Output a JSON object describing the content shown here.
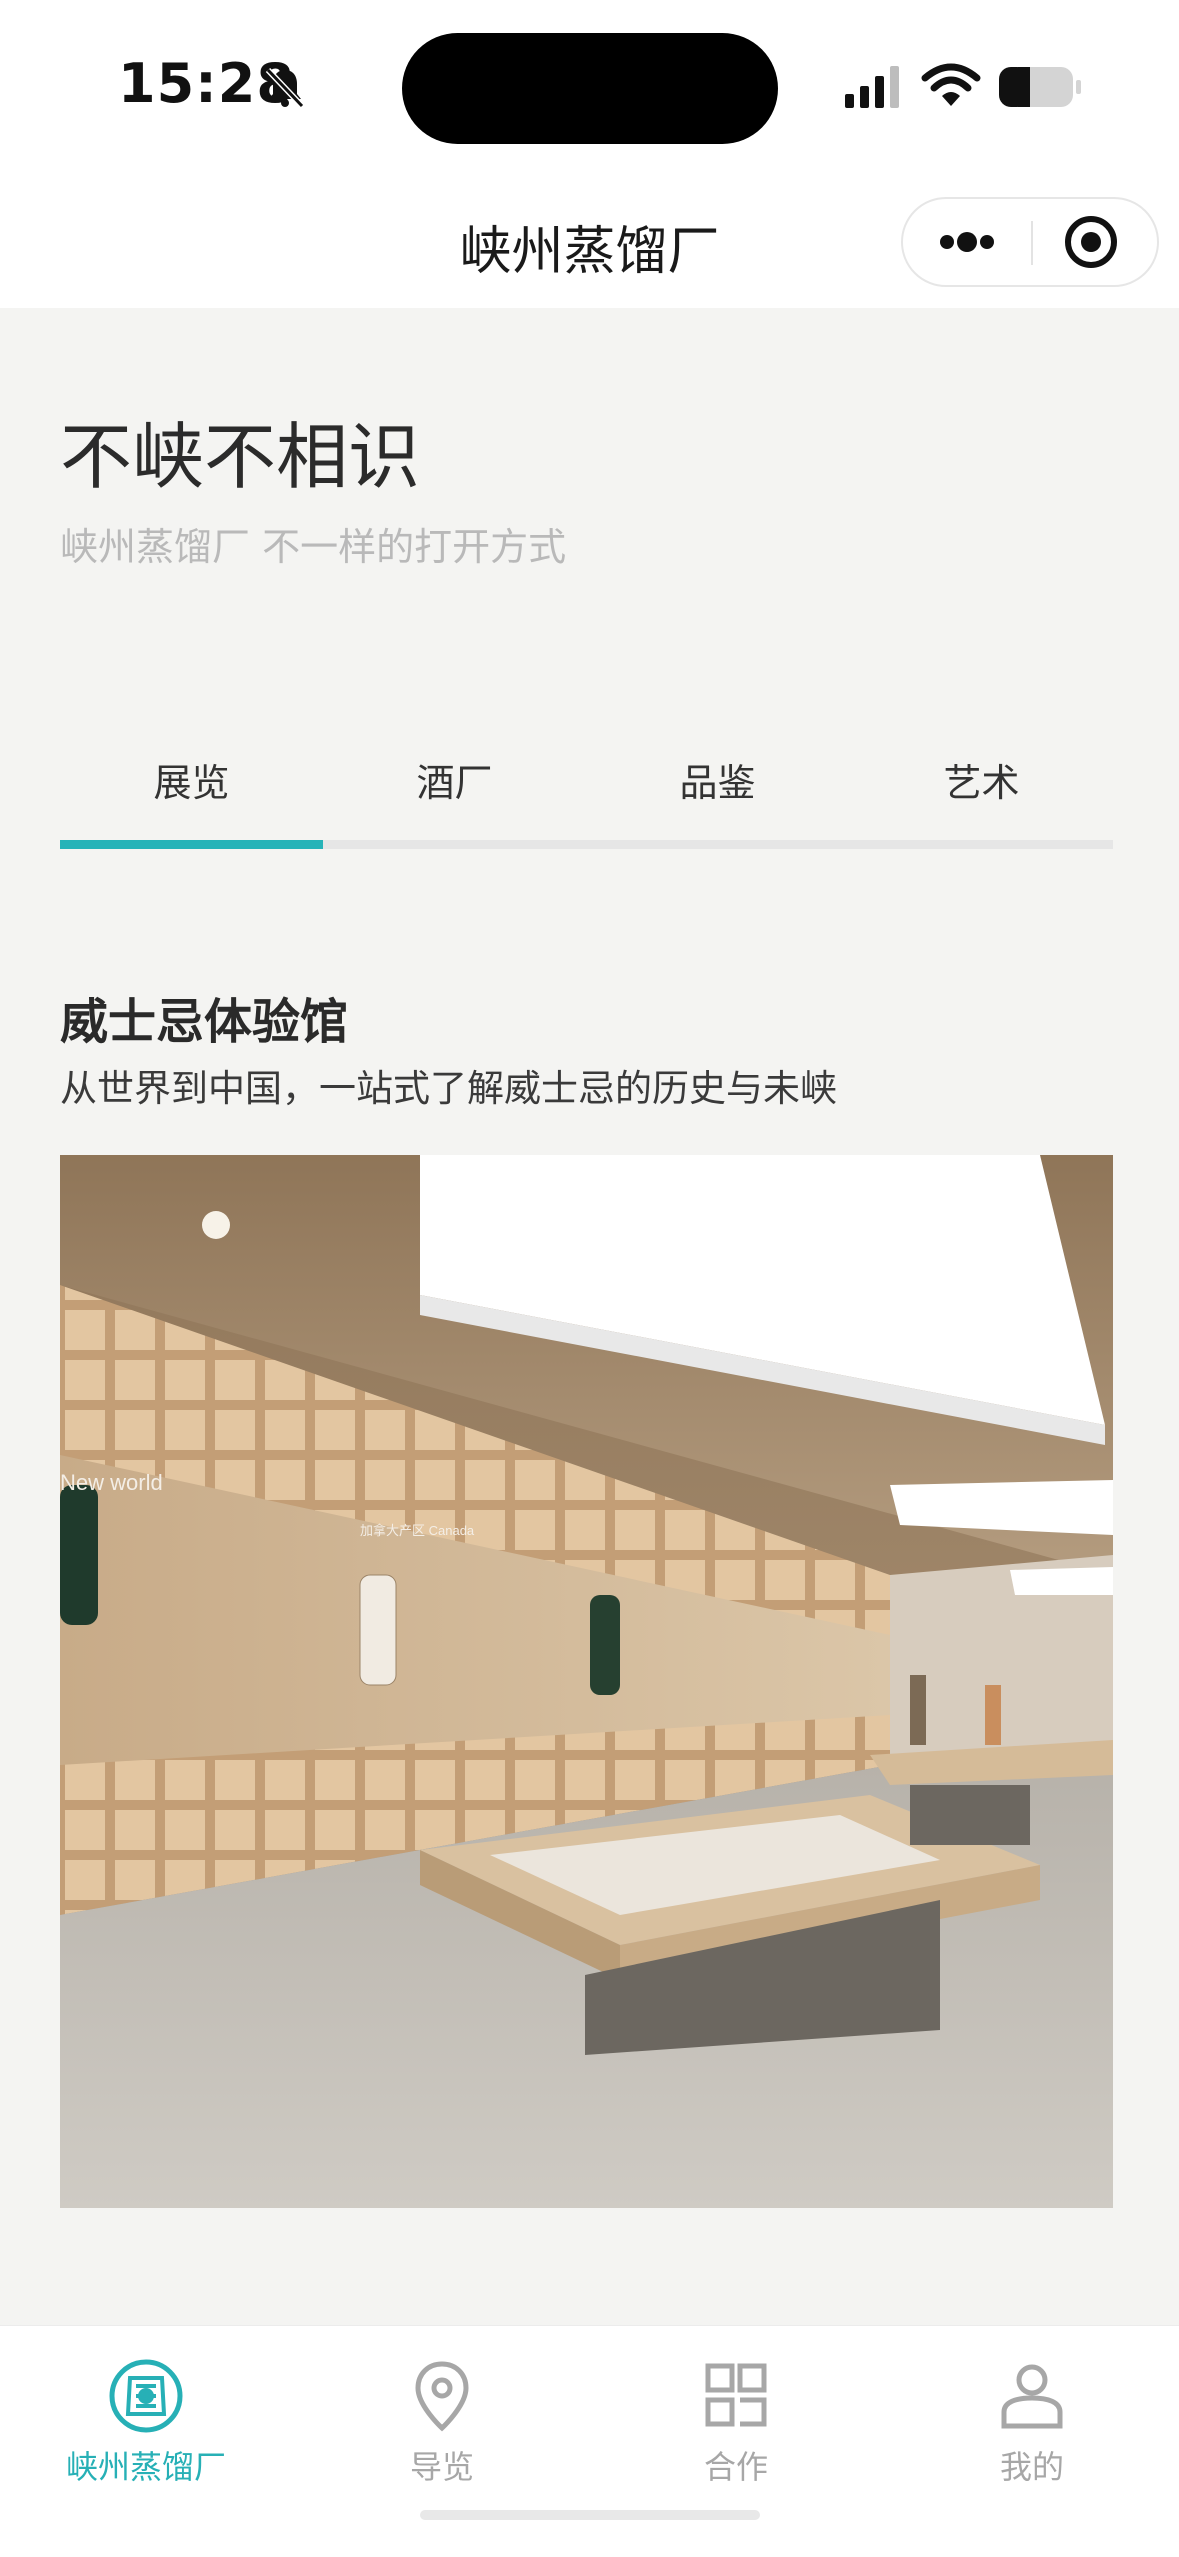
{
  "status_bar": {
    "time": "15:28"
  },
  "nav": {
    "title": "峡州蒸馏厂"
  },
  "hero": {
    "title": "不峡不相识",
    "subtitle": "峡州蒸馏厂 不一样的打开方式"
  },
  "tabs": [
    {
      "label": "展览",
      "active": true
    },
    {
      "label": "酒厂",
      "active": false
    },
    {
      "label": "品鉴",
      "active": false
    },
    {
      "label": "艺术",
      "active": false
    }
  ],
  "section": {
    "title": "威士忌体验馆",
    "subtitle": "从世界到中国，一站式了解威士忌的历史与未峡",
    "photo_texts": {
      "wall_region": "New world",
      "wall_sign": "加拿大产区 Canada"
    }
  },
  "tabbar": {
    "items": [
      {
        "label": "峡州蒸馏厂",
        "icon": "distillery-logo-icon",
        "active": true
      },
      {
        "label": "导览",
        "icon": "location-pin-icon",
        "active": false
      },
      {
        "label": "合作",
        "icon": "grid-blocks-icon",
        "active": false
      },
      {
        "label": "我的",
        "icon": "user-profile-icon",
        "active": false
      }
    ]
  },
  "colors": {
    "accent": "#26b3b8",
    "background": "#f4f4f2",
    "muted_text": "#b9b9b9"
  }
}
